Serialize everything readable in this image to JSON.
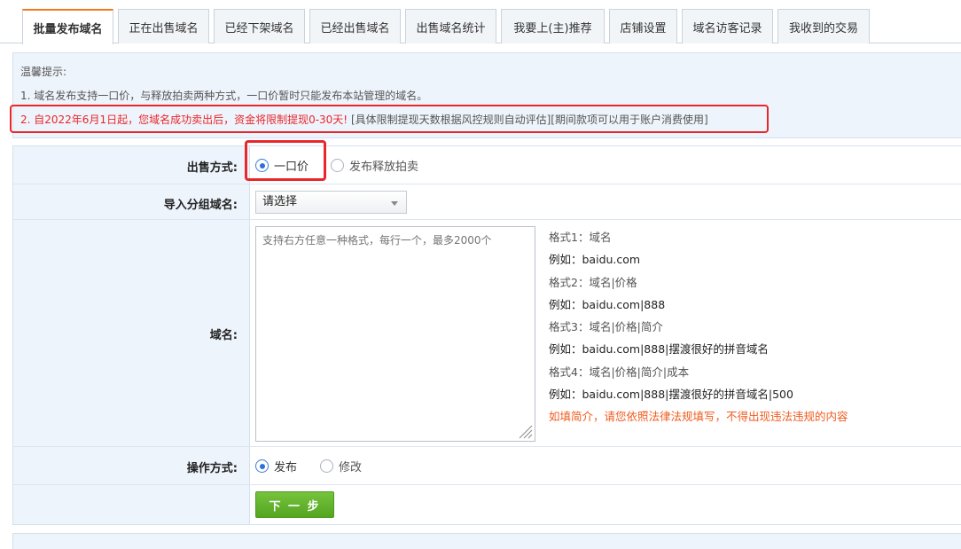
{
  "tabs": [
    {
      "label": "批量发布域名",
      "active": true
    },
    {
      "label": "正在出售域名"
    },
    {
      "label": "已经下架域名"
    },
    {
      "label": "已经出售域名"
    },
    {
      "label": "出售域名统计"
    },
    {
      "label": "我要上(主)推荐"
    },
    {
      "label": "店铺设置"
    },
    {
      "label": "域名访客记录"
    },
    {
      "label": "我收到的交易"
    }
  ],
  "tips": {
    "title": "温馨提示:",
    "line1": "1. 域名发布支持一口价，与释放拍卖两种方式，一口价暂时只能发布本站管理的域名。",
    "line2_red": "2. 自2022年6月1日起，您域名成功卖出后，资金将限制提现0-30天!",
    "line2_gray": " [具体限制提现天数根据风控规则自动评估][期间款项可以用于账户消费使用]"
  },
  "form": {
    "sale_method": {
      "label": "出售方式:",
      "options": [
        "一口价",
        "发布释放拍卖"
      ],
      "selected": "一口价"
    },
    "import_group": {
      "label": "导入分组域名:",
      "value": "请选择"
    },
    "domains": {
      "label": "域名:",
      "placeholder": "支持右方任意一种格式，每行一个，最多2000个"
    },
    "formats": {
      "f1": "格式1：域名",
      "e1": "例如：baidu.com",
      "f2": "格式2：域名|价格",
      "e2": "例如：baidu.com|888",
      "f3": "格式3：域名|价格|简介",
      "e3": "例如：baidu.com|888|摆渡很好的拼音域名",
      "f4": "格式4：域名|价格|简介|成本",
      "e4": "例如：baidu.com|888|摆渡很好的拼音域名|500",
      "notice": "如填简介，请您依照法律法规填写，不得出现违法违规的内容"
    },
    "operation": {
      "label": "操作方式:",
      "options": [
        "发布",
        "修改"
      ],
      "selected": "发布"
    },
    "next_button": "下 一 步"
  },
  "colors": {
    "accent_tab": "#f27a1c",
    "highlight": "#e8272b",
    "radio_on": "#2f6fd8",
    "button": "#5aab27",
    "notice": "#f05b1f"
  }
}
